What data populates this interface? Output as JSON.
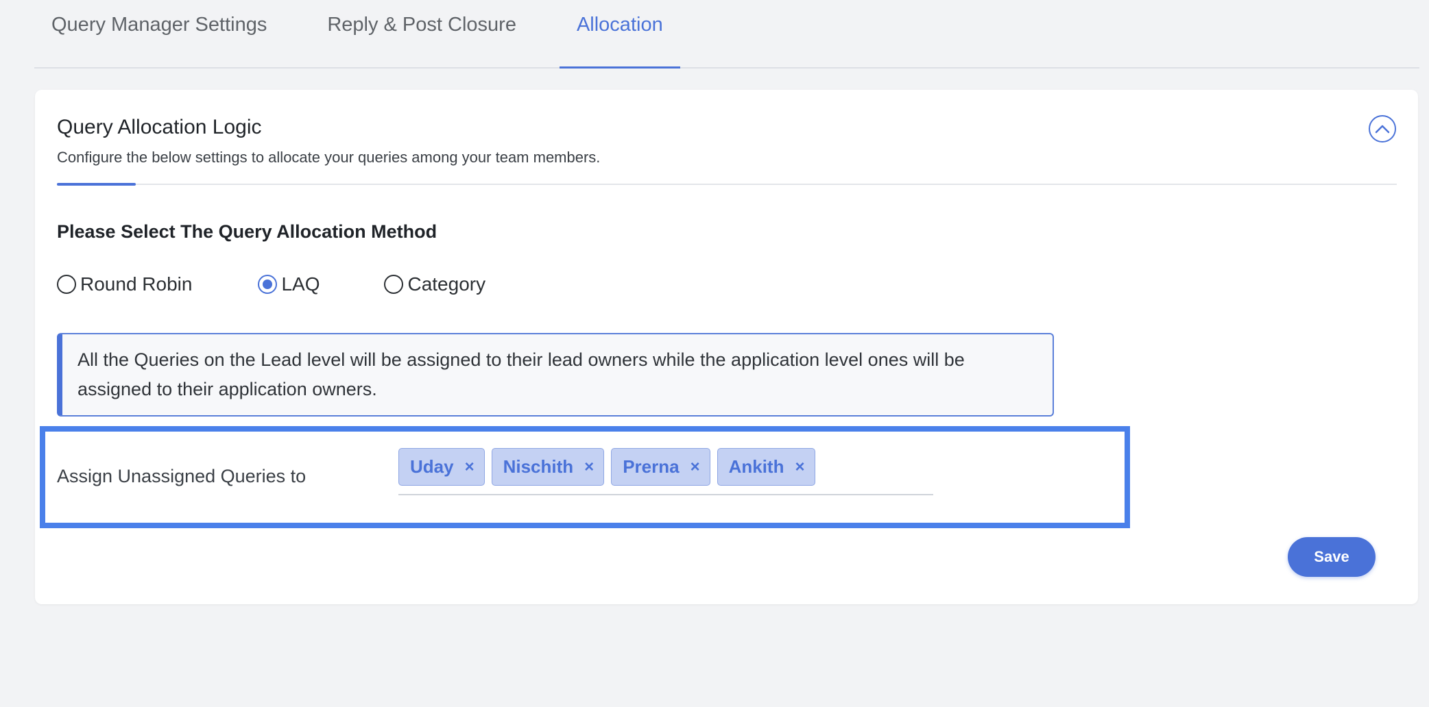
{
  "tabs": [
    {
      "label": "Query Manager Settings",
      "active": false
    },
    {
      "label": "Reply & Post Closure",
      "active": false
    },
    {
      "label": "Allocation",
      "active": true
    }
  ],
  "card": {
    "title": "Query Allocation Logic",
    "subtitle": "Configure the below settings to allocate your queries among your team members.",
    "collapse_icon": "chevron-up-icon"
  },
  "allocation": {
    "section_label": "Please Select The Query Allocation Method",
    "options": [
      {
        "label": "Round Robin",
        "checked": false
      },
      {
        "label": "LAQ",
        "checked": true
      },
      {
        "label": "Category",
        "checked": false
      }
    ],
    "info_text": "All the Queries on the Lead level will be assigned to their lead owners while the application level ones will be assigned to their application owners."
  },
  "assign": {
    "label": "Assign Unassigned Queries to",
    "chips": [
      "Uday",
      "Nischith",
      "Prerna",
      "Ankith"
    ],
    "remove_glyph": "×"
  },
  "actions": {
    "save_label": "Save"
  },
  "colors": {
    "accent": "#4a72d8",
    "highlight": "#4a80ea",
    "chip_bg": "#c4d1f3"
  }
}
